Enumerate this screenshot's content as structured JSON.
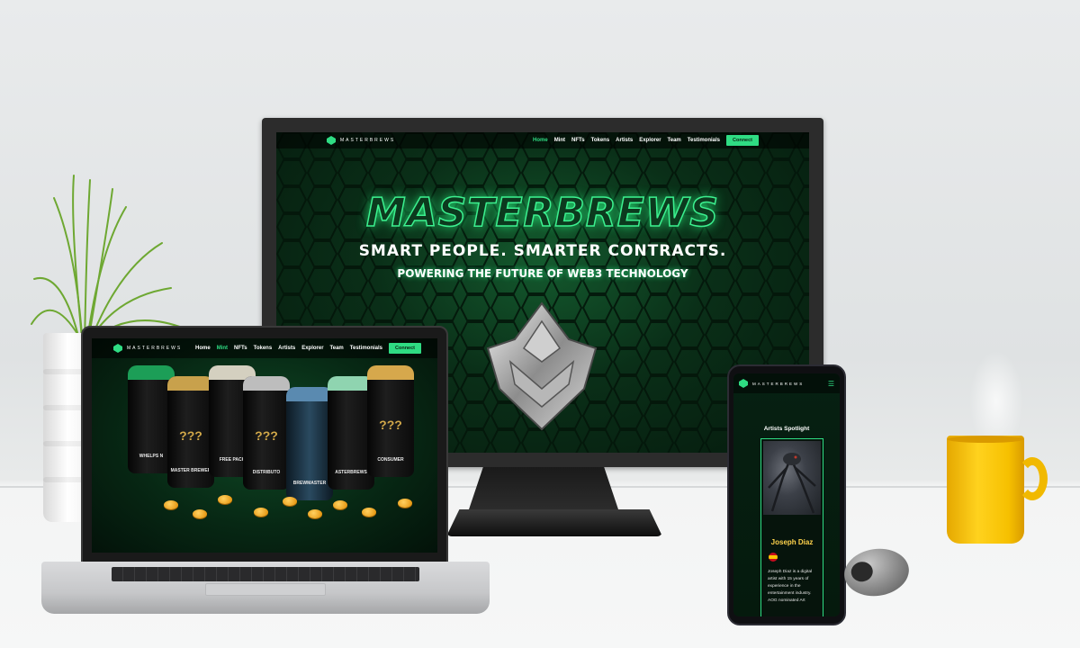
{
  "monitor": {
    "brand": "MASTERBREWS",
    "nav_items": [
      "Home",
      "Mint",
      "NFTs",
      "Tokens",
      "Artists",
      "Explorer",
      "Team",
      "Testimonials"
    ],
    "active_item": "Home",
    "connect_label": "Connect",
    "hero_title": "MASTERBREWS",
    "hero_subtitle": "SMART PEOPLE. SMARTER CONTRACTS.",
    "hero_tagline": "POWERING THE FUTURE OF WEB3 TECHNOLOGY"
  },
  "laptop": {
    "brand": "MASTERBREWS",
    "nav_items": [
      "Home",
      "Mint",
      "NFTs",
      "Tokens",
      "Artists",
      "Explorer",
      "Team",
      "Testimonials"
    ],
    "active_item": "Mint",
    "connect_label": "Connect",
    "cans": [
      {
        "label": "WHELPS N",
        "mark": "",
        "lid": "#1c9e57"
      },
      {
        "label": "MASTER BREWER",
        "mark": "???",
        "lid": "#c8a14c"
      },
      {
        "label": "FREE PACK",
        "mark": "",
        "lid": "#d4d0c0"
      },
      {
        "label": "DISTRIBUTO",
        "mark": "???",
        "lid": "#bdbdbd"
      },
      {
        "label": "BREWMASTER",
        "mark": "",
        "lid": "#5a8ab0"
      },
      {
        "label": "ASTERBREWS",
        "mark": "",
        "lid": "#8fd4b0"
      },
      {
        "label": "CONSUMER",
        "mark": "???",
        "lid": "#d6a84c"
      }
    ]
  },
  "phone": {
    "brand": "MASTERBREWS",
    "menu_icon": "hamburger-icon",
    "section_title": "Artists Spotlight",
    "artist_name": "Joseph Diaz",
    "artist_flag": "spain-flag",
    "artist_bio": "Joseph Diaz is a digital artist with 15 years of experience in the entertainment industry. AOG nominated Art"
  },
  "colors": {
    "accent": "#2fdc83",
    "name_highlight": "#ffd34c",
    "mug": "#ffd21e"
  }
}
